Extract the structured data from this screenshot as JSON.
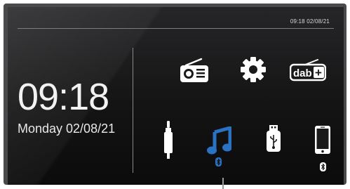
{
  "status_bar": {
    "datetime": "09:18  02/08/21"
  },
  "clock": {
    "time": "09:18",
    "date": "Monday 02/08/21"
  },
  "sources": {
    "fm_radio": "radio-icon",
    "settings": "gear-icon",
    "dab": {
      "icon": "dab-radio-icon",
      "text": "dab",
      "plus": "+"
    },
    "aux": "aux-jack-icon",
    "bluetooth_music": {
      "icon": "music-note-icon",
      "selected": true
    },
    "usb": "usb-stick-icon",
    "phone": "phone-icon"
  },
  "colors": {
    "accent": "#2a72c3",
    "icon": "#ffffff",
    "text": "#f2f2f2"
  }
}
